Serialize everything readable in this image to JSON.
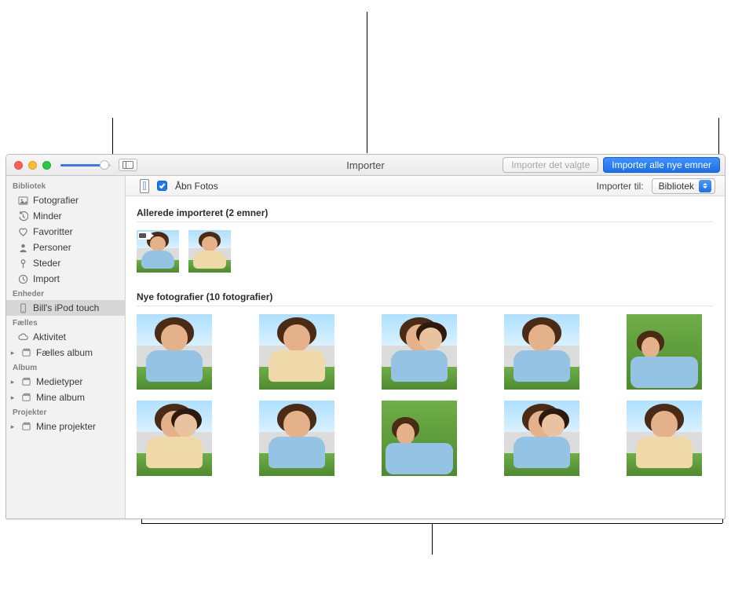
{
  "titlebar": {
    "title": "Importer",
    "btn_import_selected": "Importer det valgte",
    "btn_import_all": "Importer alle nye emner"
  },
  "importbar": {
    "open_photos_label": "Åbn Fotos",
    "open_photos_checked": true,
    "import_to_label": "Importer til:",
    "import_to_value": "Bibliotek"
  },
  "sidebar": {
    "groups": [
      {
        "label": "Bibliotek",
        "items": [
          {
            "label": "Fotografier",
            "icon": "photos",
            "selected": false
          },
          {
            "label": "Minder",
            "icon": "clock-back",
            "selected": false
          },
          {
            "label": "Favoritter",
            "icon": "heart",
            "selected": false
          },
          {
            "label": "Personer",
            "icon": "person",
            "selected": false
          },
          {
            "label": "Steder",
            "icon": "pin",
            "selected": false
          },
          {
            "label": "Import",
            "icon": "clock",
            "selected": false
          }
        ]
      },
      {
        "label": "Enheder",
        "items": [
          {
            "label": "Bill's iPod touch",
            "icon": "device",
            "selected": true
          }
        ]
      },
      {
        "label": "Fælles",
        "items": [
          {
            "label": "Aktivitet",
            "icon": "cloud",
            "selected": false
          },
          {
            "label": "Fælles album",
            "icon": "album",
            "selected": false,
            "disclosure": true
          }
        ]
      },
      {
        "label": "Album",
        "items": [
          {
            "label": "Medietyper",
            "icon": "album",
            "selected": false,
            "disclosure": true
          },
          {
            "label": "Mine album",
            "icon": "album",
            "selected": false,
            "disclosure": true
          }
        ]
      },
      {
        "label": "Projekter",
        "items": [
          {
            "label": "Mine projekter",
            "icon": "album",
            "selected": false,
            "disclosure": true
          }
        ]
      }
    ]
  },
  "sections": {
    "already_imported": {
      "header": "Allerede importeret (2 emner)",
      "count": 2,
      "items": [
        {
          "kind": "video"
        },
        {
          "kind": "photo"
        }
      ]
    },
    "new_photos": {
      "header": "Nye fotografier (10 fotografier)",
      "count": 10,
      "items": [
        {
          "kind": "photo"
        },
        {
          "kind": "photo"
        },
        {
          "kind": "photo"
        },
        {
          "kind": "photo"
        },
        {
          "kind": "photo"
        },
        {
          "kind": "photo"
        },
        {
          "kind": "photo"
        },
        {
          "kind": "photo"
        },
        {
          "kind": "photo"
        },
        {
          "kind": "photo"
        }
      ]
    }
  }
}
